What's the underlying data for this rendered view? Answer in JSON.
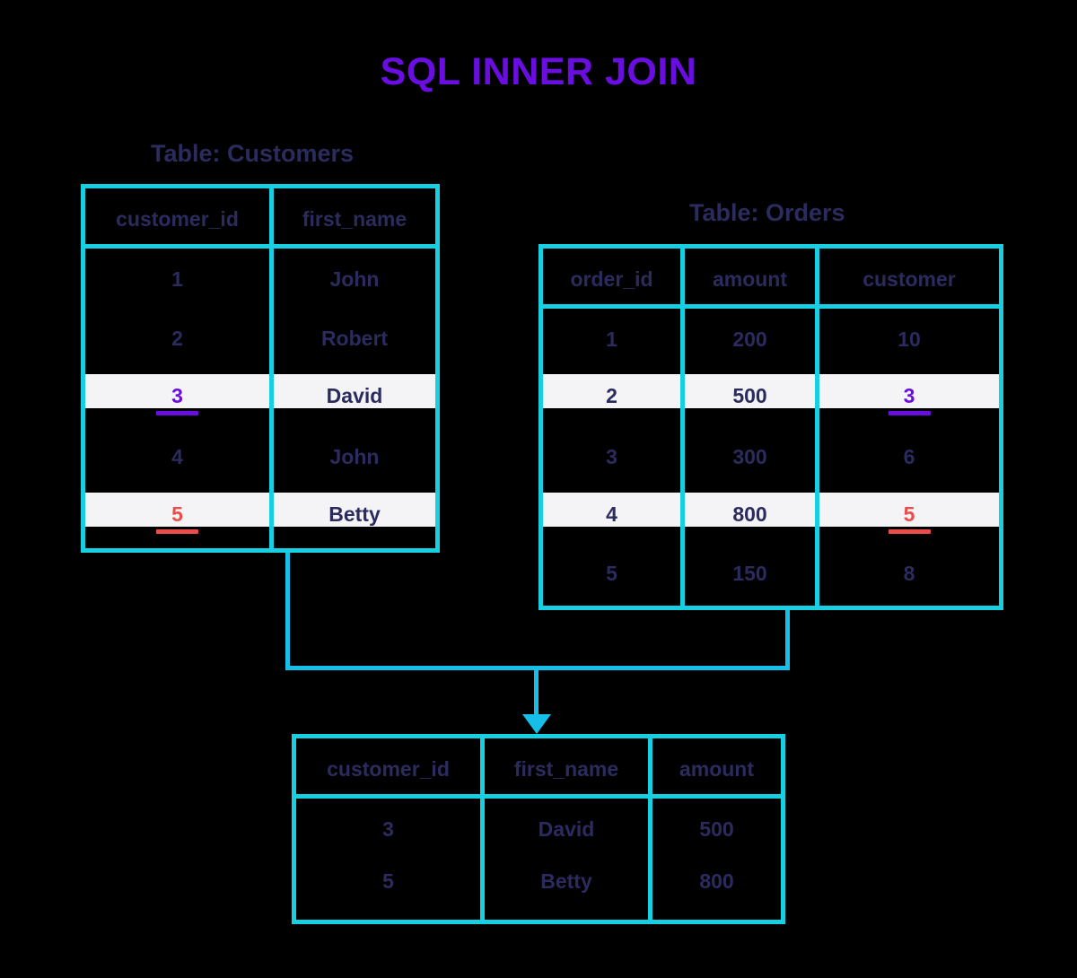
{
  "title": "SQL INNER JOIN",
  "colors": {
    "title": "#6a0de0",
    "border": "#16cfe0",
    "connector": "#16bfe8",
    "text": "#2b2b5e",
    "highlight_row": "#f4f4f6",
    "key_purple": "#6a0de0",
    "key_red": "#eb4d4b",
    "background": "#000000"
  },
  "customers_table": {
    "caption": "Table: Customers",
    "columns": [
      "customer_id",
      "first_name"
    ],
    "rows": [
      {
        "customer_id": "1",
        "first_name": "John",
        "highlighted": false,
        "key_color": ""
      },
      {
        "customer_id": "2",
        "first_name": "Robert",
        "highlighted": false,
        "key_color": ""
      },
      {
        "customer_id": "3",
        "first_name": "David",
        "highlighted": true,
        "key_color": "purple"
      },
      {
        "customer_id": "4",
        "first_name": "John",
        "highlighted": false,
        "key_color": ""
      },
      {
        "customer_id": "5",
        "first_name": "Betty",
        "highlighted": true,
        "key_color": "red"
      }
    ]
  },
  "orders_table": {
    "caption": "Table: Orders",
    "columns": [
      "order_id",
      "amount",
      "customer"
    ],
    "rows": [
      {
        "order_id": "1",
        "amount": "200",
        "customer": "10",
        "highlighted": false,
        "key_color": ""
      },
      {
        "order_id": "2",
        "amount": "500",
        "customer": "3",
        "highlighted": true,
        "key_color": "purple"
      },
      {
        "order_id": "3",
        "amount": "300",
        "customer": "6",
        "highlighted": false,
        "key_color": ""
      },
      {
        "order_id": "4",
        "amount": "800",
        "customer": "5",
        "highlighted": true,
        "key_color": "red"
      },
      {
        "order_id": "5",
        "amount": "150",
        "customer": "8",
        "highlighted": false,
        "key_color": ""
      }
    ]
  },
  "result_table": {
    "columns": [
      "customer_id",
      "first_name",
      "amount"
    ],
    "rows": [
      {
        "customer_id": "3",
        "first_name": "David",
        "amount": "500"
      },
      {
        "customer_id": "5",
        "first_name": "Betty",
        "amount": "800"
      }
    ]
  }
}
